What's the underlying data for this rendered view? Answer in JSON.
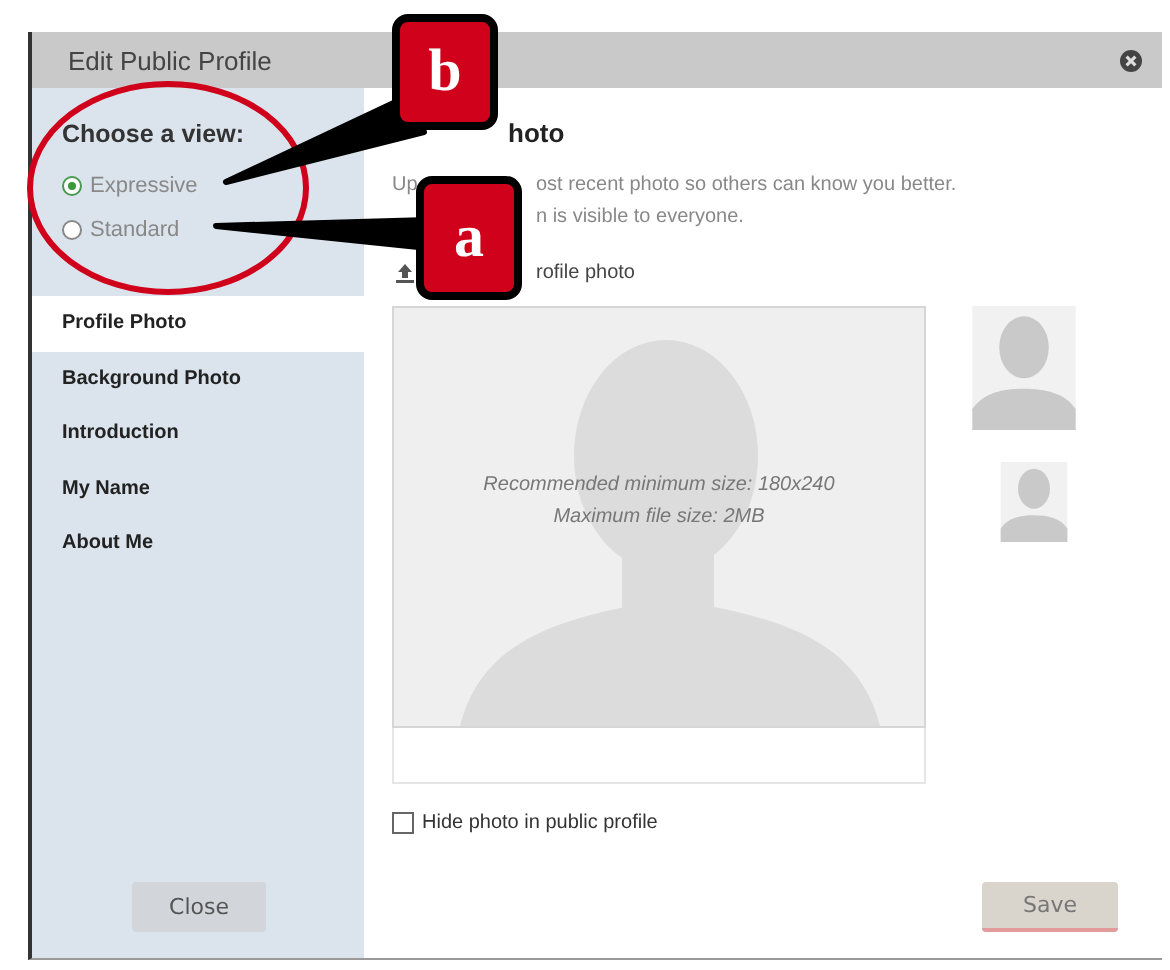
{
  "window": {
    "title": "Edit Public Profile"
  },
  "view_chooser": {
    "heading": "Choose a view:",
    "options": [
      {
        "label": "Expressive",
        "selected": true
      },
      {
        "label": "Standard",
        "selected": false
      }
    ]
  },
  "sidebar": {
    "items": [
      {
        "label": "Profile Photo",
        "selected": true
      },
      {
        "label": "Background Photo",
        "selected": false
      },
      {
        "label": "Introduction",
        "selected": false
      },
      {
        "label": "My Name",
        "selected": false
      },
      {
        "label": "About Me",
        "selected": false
      }
    ],
    "close_button": "Close"
  },
  "main": {
    "title_fragment": "hoto",
    "description_lines": [
      {
        "left": "Up",
        "right": "ost recent photo so others can know you better."
      },
      {
        "right": "n is visible to everyone."
      }
    ],
    "upload_link_fragment": "rofile photo",
    "photo_hints": [
      "Recommended minimum size: 180x240",
      "Maximum file size: 2MB"
    ],
    "hide_photo": {
      "label": "Hide photo in public profile",
      "checked": false
    },
    "save_button": {
      "label": "Save",
      "disabled": true
    }
  },
  "annotations": [
    {
      "label": "b"
    },
    {
      "label": "a"
    }
  ]
}
